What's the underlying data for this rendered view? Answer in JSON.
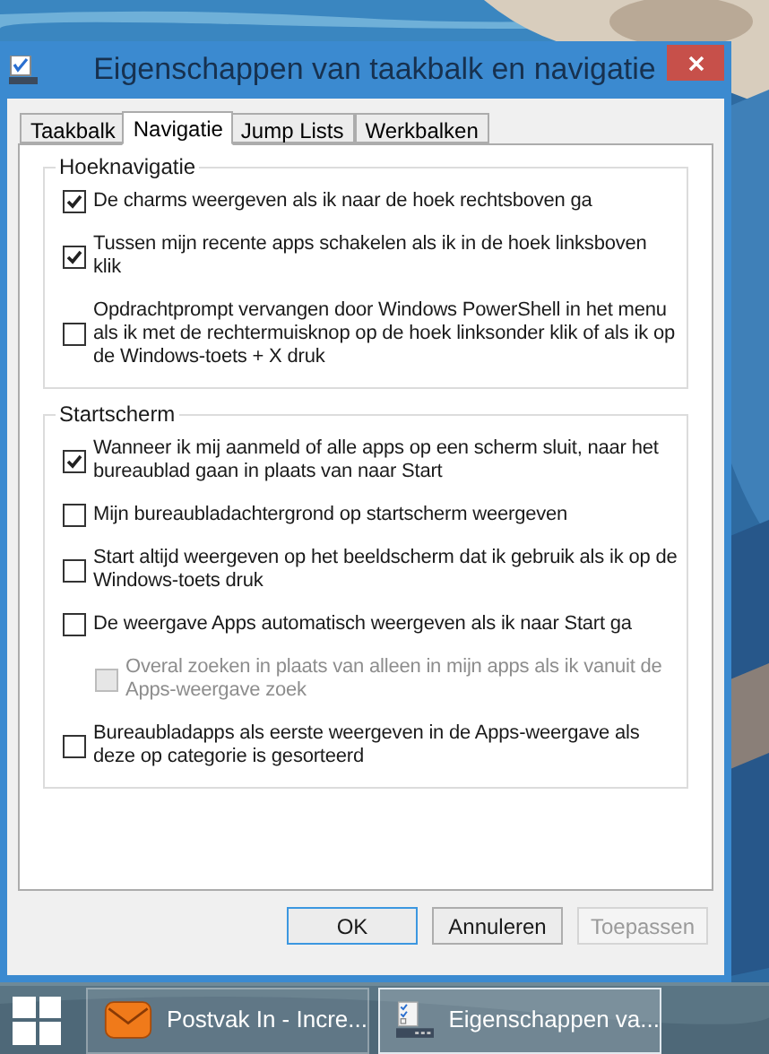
{
  "window": {
    "title": "Eigenschappen van taakbalk en navigatie"
  },
  "tabs": [
    {
      "label": "Taakbalk",
      "selected": false
    },
    {
      "label": "Navigatie",
      "selected": true
    },
    {
      "label": "Jump Lists",
      "selected": false
    },
    {
      "label": "Werkbalken",
      "selected": false
    }
  ],
  "groups": [
    {
      "title": "Hoeknavigatie",
      "options": [
        {
          "label": "De charms weergeven als ik naar de hoek rechtsboven ga",
          "checked": true,
          "disabled": false
        },
        {
          "label": "Tussen mijn recente apps schakelen als ik in de hoek linksboven klik",
          "checked": true,
          "disabled": false
        },
        {
          "label": "Opdrachtprompt vervangen door Windows PowerShell in het menu als ik met de rechtermuisknop op de hoek linksonder klik of als ik op de Windows-toets + X druk",
          "checked": false,
          "disabled": false
        }
      ]
    },
    {
      "title": "Startscherm",
      "options": [
        {
          "label": "Wanneer ik mij aanmeld of alle apps op een scherm sluit, naar het bureaublad gaan in plaats van naar Start",
          "checked": true,
          "disabled": false
        },
        {
          "label": "Mijn bureaubladachtergrond op startscherm weergeven",
          "checked": false,
          "disabled": false
        },
        {
          "label": "Start altijd weergeven op het beeldscherm dat ik gebruik als ik op de Windows-toets druk",
          "checked": false,
          "disabled": false
        },
        {
          "label": "De weergave Apps automatisch weergeven als ik naar Start ga",
          "checked": false,
          "disabled": false,
          "children": [
            {
              "label": "Overal zoeken in plaats van alleen in mijn apps als ik vanuit de Apps-weergave zoek",
              "checked": false,
              "disabled": true
            }
          ]
        },
        {
          "label": "Bureaubladapps als eerste weergeven in de Apps-weergave als deze op categorie is gesorteerd",
          "checked": false,
          "disabled": false
        }
      ]
    }
  ],
  "buttons": [
    {
      "label": "OK",
      "default": true,
      "disabled": false
    },
    {
      "label": "Annuleren",
      "default": false,
      "disabled": false
    },
    {
      "label": "Toepassen",
      "default": false,
      "disabled": true
    }
  ],
  "taskbar": {
    "items": [
      {
        "label": "Postvak In - Incre...",
        "kind": "mail",
        "selected": false
      },
      {
        "label": "Eigenschappen va...",
        "kind": "properties",
        "selected": true
      }
    ]
  }
}
